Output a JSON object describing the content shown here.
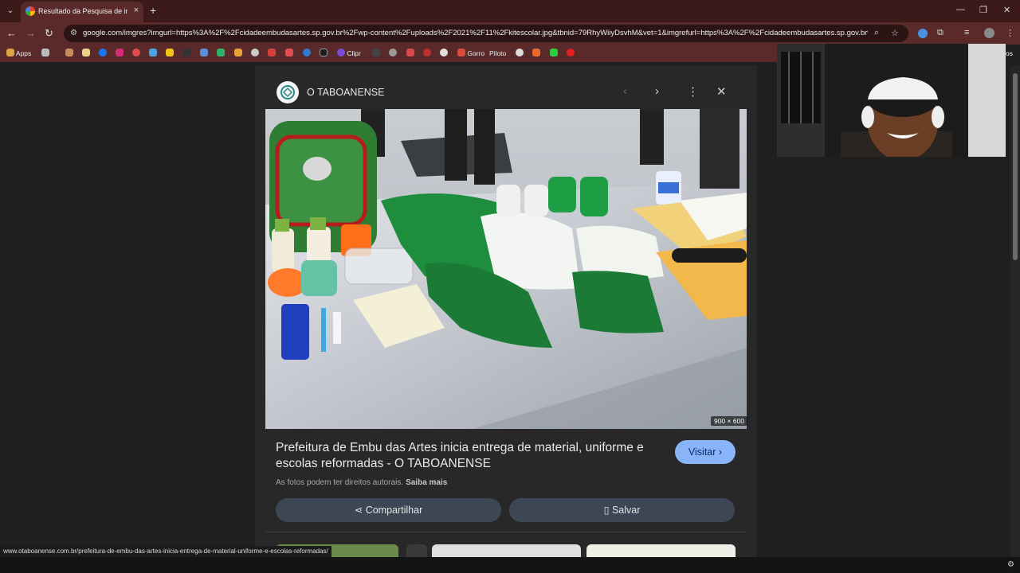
{
  "browser": {
    "tab": {
      "title": "Resultado da Pesquisa de imag",
      "close": "×"
    },
    "new_tab": "+",
    "window": {
      "minimize": "—",
      "restore": "❐",
      "close": "✕"
    },
    "nav": {
      "back": "←",
      "forward": "→",
      "reload": "↻"
    },
    "url": "google.com/imgres?imgurl=https%3A%2F%2Fcidadeembudasartes.sp.gov.br%2Fwp-content%2Fuploads%2F2021%2F11%2Fkitescolar.jpg&tbnid=79RhyWiiyDsvhM&vet=1&imgrefurl=https%3A%2F%2Fcidadeembudasartes.sp.gov.br%2F...",
    "bookmarks": {
      "apps": "Apps",
      "clipr": "Clipr",
      "gorro": "Gorro",
      "piloto": "Piloto",
      "overflow": "os"
    }
  },
  "panel": {
    "source_name": "O TABOANENSE",
    "image_dims": "900 × 600",
    "title": "Prefeitura de Embu das Artes inicia entrega de material, uniforme e escolas reformadas - O TABOANENSE",
    "visit_label": "Visitar",
    "copyright": "As fotos podem ter direitos autorais.",
    "learn_more": "Saiba mais",
    "share_label": "Compartilhar",
    "save_label": "Salvar"
  },
  "status_url": "www.otaboanense.com.br/prefeitura-de-embu-das-artes-inicia-entrega-de-material-uniforme-e-escolas-reformadas/",
  "colors": {
    "tab_strip": "#3c1a1a",
    "toolbar": "#5a2a2a",
    "page_bg": "#1f1f1f",
    "panel_bg": "#282828",
    "visit_button": "#8ab4f8",
    "action_button": "#3d4654"
  }
}
